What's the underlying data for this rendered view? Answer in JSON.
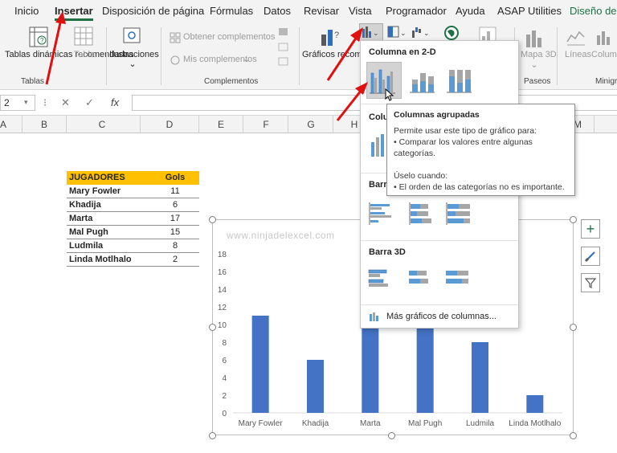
{
  "tabs": [
    "Inicio",
    "Insertar",
    "Disposición de página",
    "Fórmulas",
    "Datos",
    "Revisar",
    "Vista",
    "Programador",
    "Ayuda",
    "ASAP Utilities",
    "Diseño de g"
  ],
  "ribbon": {
    "pivot_label": "Tablas dinámicas recomendadas",
    "table_label": "Tabla",
    "illustrations_label": "Ilustraciones",
    "get_addins_label": "Obtener complementos",
    "my_addins_label": "Mis complementos",
    "recommended_charts_label": "Gráficos recomendados",
    "map3d_label": "Mapa 3D",
    "lines_label": "Líneas",
    "column_label": "Column",
    "groups": {
      "tables": "Tablas",
      "addins": "Complementos",
      "tours": "Paseos",
      "sparklines": "Minigr"
    }
  },
  "formula_bar": {
    "name_box": "2",
    "fx": "fx"
  },
  "columns": [
    "A",
    "B",
    "C",
    "D",
    "E",
    "F",
    "G",
    "H",
    "M"
  ],
  "table": {
    "headers": [
      "JUGADORES",
      "Gols"
    ],
    "rows": [
      [
        "Mary Fowler",
        "11"
      ],
      [
        "Khadija",
        "6"
      ],
      [
        "Marta",
        "17"
      ],
      [
        "Mal Pugh",
        "15"
      ],
      [
        "Ludmila",
        "8"
      ],
      [
        "Linda Motlhalo",
        "2"
      ]
    ]
  },
  "watermark": "www.ninjadelexcel.com",
  "chart_data": {
    "type": "bar",
    "categories": [
      "Mary Fowler",
      "Khadija",
      "Marta",
      "Mal Pugh",
      "Ludmila",
      "Linda Motlhalo"
    ],
    "values": [
      11,
      6,
      17,
      15,
      8,
      2
    ],
    "ylim": [
      0,
      18
    ],
    "yticks": [
      0,
      2,
      4,
      6,
      8,
      10,
      12,
      14,
      16,
      18
    ],
    "bar_color": "#4472c4",
    "grid": false,
    "legend": "none",
    "title": ""
  },
  "dropdown": {
    "section_2d_column": "Columna en 2-D",
    "section_3d_column": "Colu",
    "section_2d_bar": "Barra",
    "section_3d_bar": "Barra 3D",
    "more_charts": "Más gráficos de columnas..."
  },
  "tooltip": {
    "title": "Columnas agrupadas",
    "lines": [
      "Permite usar este tipo de gráfico para:",
      "• Comparar los valores entre algunas",
      "categorías.",
      "",
      "Úselo cuando:",
      "• El orden de las categorías no es importante."
    ]
  },
  "colors": {
    "accent": "#1f7145",
    "header_fill": "#ffc000",
    "arrow": "#e01010"
  }
}
